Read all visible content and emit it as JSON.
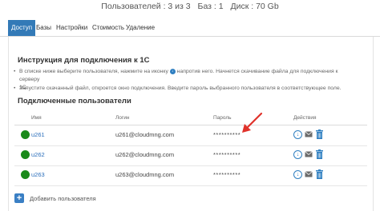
{
  "stats": {
    "users": "Пользователей : 3 из 3",
    "bases": "Баз : 1",
    "disk": "Диск : 70 Gb"
  },
  "tabs": [
    {
      "label": "Доступ",
      "active": true
    },
    {
      "label": "Базы",
      "active": false
    },
    {
      "label": "Настройки",
      "active": false
    },
    {
      "label": "Стоимость",
      "active": false
    },
    {
      "label": "Удаление",
      "active": false
    }
  ],
  "instructions": {
    "title": "Инструкция для подключения к 1С",
    "step1_part1": "В списке ниже выберите пользователя, нажмите на иконку",
    "step1_part2": "напротив него. Начнется скачивание файла для подключения к серверу",
    "step1_part3": "1С.",
    "step2": "Запустите скачанный файл, откроется окно подключения. Введите пароль выбранного пользователя в соответствующее поле."
  },
  "users_section": {
    "title": "Подключенные пользователи",
    "columns": {
      "name": "Имя",
      "login": "Логин",
      "password": "Пароль",
      "actions": "Действия"
    },
    "rows": [
      {
        "name": "u261",
        "login": "u261@cloudmng.com",
        "password": "**********",
        "status_color": "#1a8a1a"
      },
      {
        "name": "u262",
        "login": "u262@cloudmng.com",
        "password": "**********",
        "status_color": "#1a8a1a"
      },
      {
        "name": "u263",
        "login": "u263@cloudmng.com",
        "password": "**********",
        "status_color": "#1a8a1a"
      }
    ],
    "add_user_label": "Добавить пользователя"
  },
  "colors": {
    "accent": "#337ab7",
    "status_online": "#1a8a1a",
    "annotation_arrow": "#e0322b"
  }
}
